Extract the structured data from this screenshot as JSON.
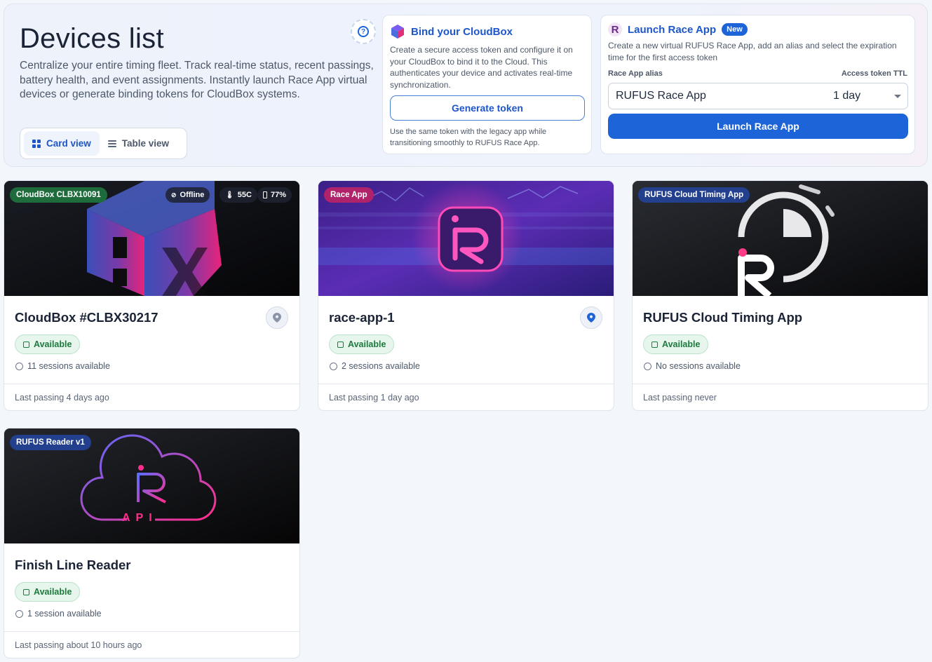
{
  "header": {
    "title": "Devices list",
    "subtitle": "Centralize your entire timing fleet. Track real-time status, recent passings, battery health, and event assignments. Instantly launch Race App virtual devices or generate binding tokens for CloudBox systems.",
    "view_toggle": {
      "card": "Card view",
      "table": "Table view"
    }
  },
  "bind_panel": {
    "title": "Bind your CloudBox",
    "description": "Create a secure access token and configure it on your CloudBox to bind it to the Cloud. This authenticates your device and activates real-time synchronization.",
    "button": "Generate token",
    "note": "Use the same token with the legacy app while transitioning smoothly to RUFUS Race App."
  },
  "launch_panel": {
    "title": "Launch Race App",
    "badge": "New",
    "description": "Create a new virtual RUFUS Race App, add an alias and select the expiration time for the first access token",
    "alias_label": "Race App alias",
    "ttl_label": "Access token TTL",
    "alias_value": "RUFUS Race App",
    "ttl_value": "1 day",
    "button": "Launch Race App"
  },
  "devices": [
    {
      "badge": "CloudBox CLBX10091",
      "stats": {
        "connection": "Offline",
        "temperature": "55C",
        "battery": "77%"
      },
      "name": "CloudBox #CLBX30217",
      "status": "Available",
      "sessions": "11 sessions available",
      "last_passing": "Last passing 4 days ago"
    },
    {
      "badge": "Race App",
      "name": "race-app-1",
      "status": "Available",
      "sessions": "2 sessions available",
      "last_passing": "Last passing 1 day ago"
    },
    {
      "badge": "RUFUS Cloud Timing App",
      "name": "RUFUS Cloud Timing App",
      "status": "Available",
      "sessions": "No sessions available",
      "last_passing": "Last passing never"
    },
    {
      "badge": "RUFUS Reader v1",
      "image_text": "API",
      "name": "Finish Line Reader",
      "status": "Available",
      "sessions": "1 session available",
      "last_passing": "Last passing about 10 hours ago"
    }
  ],
  "colors": {
    "primary": "#1d64d8",
    "cloudbox_badge": "#1e6b3c",
    "raceapp_badge": "#b0226a",
    "cloudtiming_badge": "#23408f",
    "status_green": "#1c7a3c"
  }
}
